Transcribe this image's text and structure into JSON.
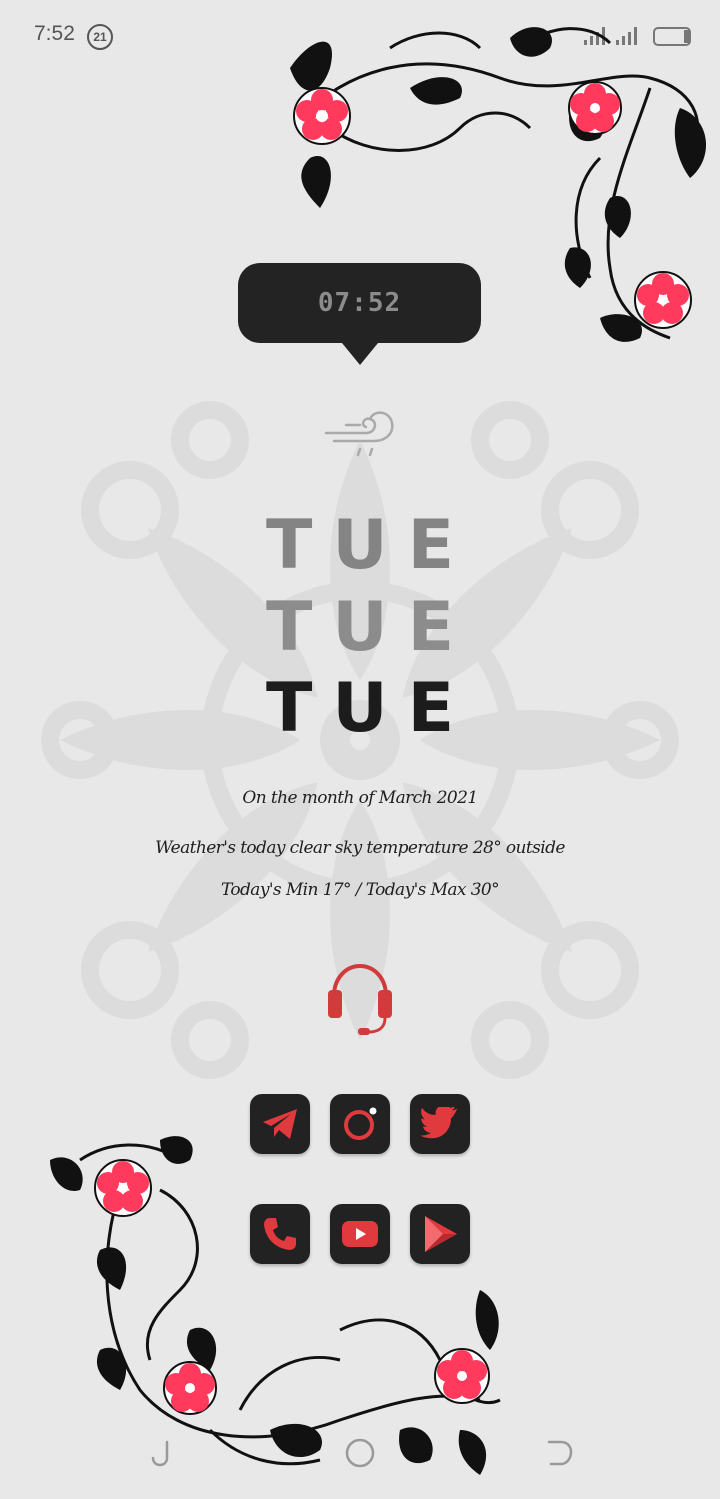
{
  "status_bar": {
    "time": "7:52",
    "notification_count": "21"
  },
  "clock_widget": {
    "time": "07:52"
  },
  "day_stack": [
    "TUE",
    "TUE",
    "TUE"
  ],
  "info_lines": {
    "month": "On the month of March 2021",
    "weather": "Weather's today clear sky temperature 28° outside",
    "min_max": "Today's Min 17° / Today's Max 30°"
  },
  "icons": {
    "weather": "wind-rain-icon",
    "headset": "headset-icon",
    "apps_row_1": [
      "telegram-icon",
      "camera-icon",
      "twitter-icon"
    ],
    "apps_row_2": [
      "phone-icon",
      "youtube-icon",
      "play-store-icon"
    ]
  },
  "colors": {
    "accent": "#e03a3e",
    "flower_pink": "#ff3a5c",
    "icon_bg": "#222222",
    "background": "#e8e8e8"
  }
}
